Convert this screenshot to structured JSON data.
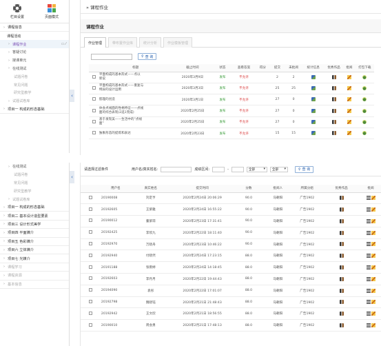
{
  "sidebar1": {
    "tiles": [
      {
        "label": "栏目设置",
        "icon": "gear-icon"
      },
      {
        "label": "页面模式",
        "icon": "palette-icon"
      }
    ],
    "items": [
      {
        "label": "课程信息",
        "kind": "section",
        "chev": "›"
      },
      {
        "label": "课程活动",
        "kind": "header"
      },
      {
        "label": "课程作业",
        "kind": "sub",
        "active": true,
        "chev": "›"
      },
      {
        "label": "答疑讨论",
        "kind": "sub",
        "chev": "›"
      },
      {
        "label": "授课单元",
        "kind": "sub",
        "chev": "›"
      },
      {
        "label": "在线测试",
        "kind": "sub",
        "chev": "›"
      },
      {
        "label": "试题问卷",
        "kind": "sub2",
        "gray": true
      },
      {
        "label": "常见问题",
        "kind": "sub2",
        "gray": true
      },
      {
        "label": "研究型教学",
        "kind": "sub2",
        "gray": true
      },
      {
        "label": "试题试卷库",
        "kind": "sub",
        "gray": true,
        "chev": "›"
      },
      {
        "label": "项目一 构成的形态基础",
        "kind": "section",
        "chev": "›"
      }
    ]
  },
  "sidebar2": {
    "items": [
      {
        "label": "在线测试",
        "kind": "sub",
        "chev": "›"
      },
      {
        "label": "试题问卷",
        "kind": "sub2",
        "gray": true
      },
      {
        "label": "常见问题",
        "kind": "sub2",
        "gray": true
      },
      {
        "label": "研究型教学",
        "kind": "sub2",
        "gray": true
      },
      {
        "label": "试题试卷库",
        "kind": "sub",
        "gray": true,
        "chev": "›"
      },
      {
        "label": "项目一 构成的形态基础",
        "kind": "section",
        "chev": "›"
      },
      {
        "label": "项目二 基本设计造型要素",
        "kind": "section",
        "chev": "›"
      },
      {
        "label": "项目三 设计形式美学",
        "kind": "section",
        "chev": "›"
      },
      {
        "label": "项目四 平面媒介",
        "kind": "section",
        "chev": "›"
      },
      {
        "label": "项目五 色彩媒介",
        "kind": "section",
        "chev": "›"
      },
      {
        "label": "项目六 立体媒介",
        "kind": "section",
        "chev": "›"
      },
      {
        "label": "项目七 光媒介",
        "kind": "section",
        "chev": "›"
      },
      {
        "label": "课程学习",
        "kind": "section",
        "chev": "›",
        "gray": true
      },
      {
        "label": "课程资源",
        "kind": "section",
        "chev": "›",
        "gray": true
      },
      {
        "label": "基本信息",
        "kind": "section",
        "chev": "›",
        "gray": true
      }
    ]
  },
  "breadcrumb": "» 课程作业",
  "panel_title": "课程作业",
  "tabs": [
    "作业管理",
    "带布置作业库",
    "统计分析",
    "作业模板管理"
  ],
  "query_label": "查 询",
  "hw_table": {
    "headers": [
      "",
      "标题",
      "截止时间",
      "状态",
      "查看答案",
      "得分",
      "提交",
      "未批阅",
      "统计信息",
      "优秀作品",
      "批阅",
      "打包下载"
    ],
    "rows": [
      {
        "title": "平面构成的基本形式——点形式、平面构成的基本形式——点以及的",
        "title_lines": [
          "平面构成的基本形式——点以",
          "新说"
        ],
        "due": "2020年3月9日",
        "status": "发布",
        "answer": "不允许",
        "score": "",
        "submit": "2",
        "unread": "2"
      },
      {
        "title": "平面构成的基本形式——重复与特异的设计运用",
        "title_lines": [
          "平面构成的基本形式——重复与",
          "特异的设计运用"
        ],
        "due": "2020年3月3日",
        "status": "发布",
        "answer": "不允许",
        "score": "",
        "submit": "25",
        "unread": "25"
      },
      {
        "title": "肌理的创造",
        "title_lines": [
          "肌理的创造"
        ],
        "due": "2020年3月1日",
        "status": "发布",
        "answer": "不允许",
        "score": "",
        "submit": "27",
        "unread": "0"
      },
      {
        "title": "体会点线面的性格特征——点线面的综合表现",
        "title_lines": [
          "体会点线面的性格特征——点线",
          "面的综合表现(2选1完成)"
        ],
        "due": "2020年2月25日",
        "status": "发布",
        "answer": "不允许",
        "score": "",
        "submit": "27",
        "unread": "0"
      },
      {
        "title": "基于发现美——生活中的“点线面”",
        "title_lines": [
          "基于发现美——生活中的“点线",
          "面”"
        ],
        "due": "2020年2月25日",
        "status": "发布",
        "answer": "不允许",
        "score": "",
        "submit": "27",
        "unread": "0"
      },
      {
        "title": "独象形态的提炼和表达",
        "title_lines": [
          "独象形态的提炼和表达"
        ],
        "due": "2020年2月23日",
        "status": "发布",
        "answer": "不允许",
        "score": "",
        "submit": "15",
        "unread": "15"
      }
    ]
  },
  "filter": {
    "label_condition": "请选择过滤条件",
    "label_user": "用户名/真实姓名:",
    "label_score": "成绩区间:",
    "dash": "-",
    "select_all_1": "全部",
    "select_all_2": "全部",
    "query_label": "查 询"
  },
  "sub_table": {
    "headers": [
      "",
      "用户名",
      "真实姓名",
      "提交时间",
      "分数",
      "批阅人",
      "所属分组",
      "优秀作品",
      "批阅"
    ],
    "rows": [
      {
        "user": "20190008",
        "name": "刘定亨",
        "time": "2020年2月24日 20:06:29",
        "score": "90.0",
        "grader": "马朝阳",
        "group": "广告1902"
      },
      {
        "user": "20192605",
        "name": "王紫雅",
        "time": "2020年2月24日 16:55:22",
        "score": "90.0",
        "grader": "马朝阳",
        "group": "广告1902"
      },
      {
        "user": "20190012",
        "name": "董紫琼",
        "time": "2020年2月23日 17:31:41",
        "score": "90.0",
        "grader": "马朝阳",
        "group": "广告1902"
      },
      {
        "user": "20192425",
        "name": "李欣九",
        "time": "2020年2月22日 18:11:40",
        "score": "90.0",
        "grader": "马朝阳",
        "group": "广告1902"
      },
      {
        "user": "20192970",
        "name": "万晓舟",
        "time": "2020年2月23日 10:46:22",
        "score": "90.0",
        "grader": "马朝阳",
        "group": "广告1902"
      },
      {
        "user": "20192940",
        "name": "付晓然",
        "time": "2020年2月24日 17:23:15",
        "score": "88.0",
        "grader": "马朝阳",
        "group": "广告1902"
      },
      {
        "user": "20191188",
        "name": "张雨婷",
        "time": "2020年2月24日 14:18:45",
        "score": "88.0",
        "grader": "马朝阳",
        "group": "广告1902"
      },
      {
        "user": "20192603",
        "name": "李丹月",
        "time": "2020年2月22日 19:44:43",
        "score": "88.0",
        "grader": "马朝阳",
        "group": "广告1902"
      },
      {
        "user": "20194090",
        "name": "袁彤",
        "time": "2020年2月22日 17:01:07",
        "score": "88.0",
        "grader": "马朝阳",
        "group": "广告1902"
      },
      {
        "user": "20192798",
        "name": "魏晓钰",
        "time": "2020年2月21日 21:48:43",
        "score": "88.0",
        "grader": "马朝阳",
        "group": "广告1902"
      },
      {
        "user": "20192942",
        "name": "王文欣",
        "time": "2020年2月21日 18:56:55",
        "score": "88.0",
        "grader": "马朝阳",
        "group": "广告1902"
      },
      {
        "user": "20190010",
        "name": "周会勇",
        "time": "2020年2月21日 17:48:13",
        "score": "88.0",
        "grader": "马朝阳",
        "group": "广告1902"
      }
    ]
  },
  "collapse_glyph": "‹",
  "colors": {
    "accent": "#2a62b8",
    "published": "#3f9f3f",
    "not_allowed": "#d93838",
    "active_nav": "#7a4fb5"
  }
}
